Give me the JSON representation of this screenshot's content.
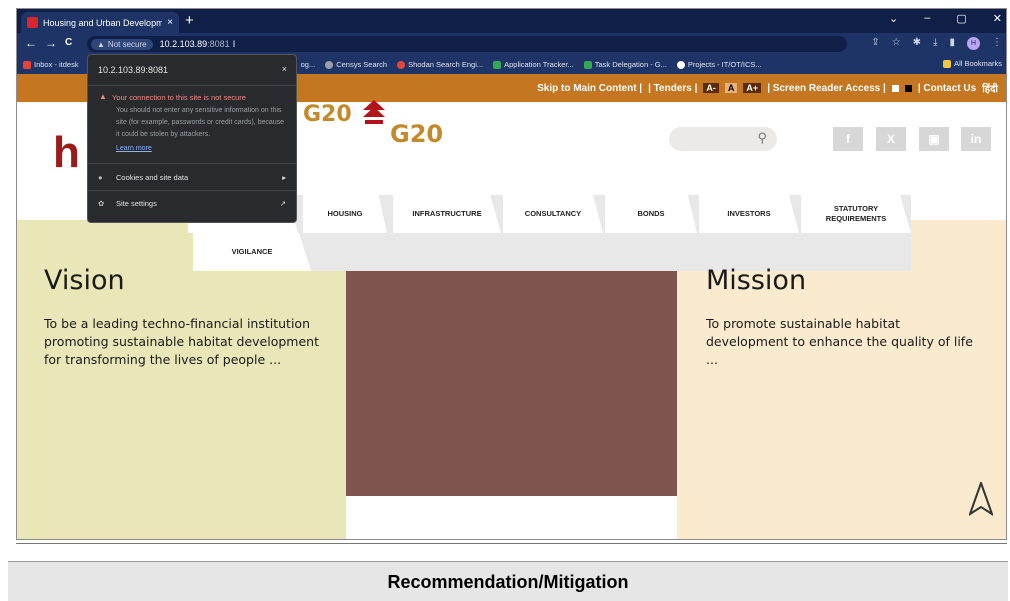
{
  "browser": {
    "tab_title": "Housing and Urban Developme",
    "tab_close": "×",
    "new_tab": "+",
    "window_controls": [
      "⌄",
      "–",
      "▢",
      "✕"
    ],
    "nav": [
      "←",
      "→",
      "C"
    ],
    "not_secure": "Not secure",
    "url_host": "10.2.103.89",
    "url_port": ":8081",
    "cursor": "I",
    "profile_initial": "H",
    "bookmarks": [
      {
        "label": "Inbox - itdesk",
        "color": "#ea4335"
      },
      {
        "label": "og...",
        "color": "#1e3366"
      },
      {
        "label": "Censys Search",
        "color": "#5f6368"
      },
      {
        "label": "Shodan Search Engi...",
        "color": "#e8453c"
      },
      {
        "label": "Application Tracker...",
        "color": "#34a853"
      },
      {
        "label": "Task Delegation - G...",
        "color": "#34a853"
      },
      {
        "label": "Projects - IT/OT/ICS...",
        "color": "#ffffff"
      }
    ],
    "all_bookmarks": "All Bookmarks"
  },
  "site_info_popup": {
    "host": "10.2.103.89:8081",
    "close": "×",
    "warning_title": "Your connection to this site is not secure",
    "warning_body": "You should not enter any sensitive information on this site (for example, passwords or credit cards), because it could be stolen by attackers.",
    "learn_more": "Learn more",
    "cookies": "Cookies and site data",
    "site_settings": "Site settings"
  },
  "site": {
    "topbar": {
      "skip": "Skip to Main Content |",
      "tenders": "| Tenders |",
      "font_minus": "A-",
      "font_normal": "A",
      "font_plus": "A+",
      "screen_reader": "| Screen Reader Access |",
      "contact": "| Contact Us",
      "hindi": "हिंदी"
    },
    "logo_text": "h",
    "g20_text": "G20",
    "social": [
      "f",
      "X",
      "▣",
      "in"
    ],
    "menu": [
      "HOUSING",
      "INFRASTRUCTURE",
      "CONSULTANCY",
      "BONDS",
      "INVESTORS",
      "STATUTORY REQUIREMENTS",
      "VIGILANCE"
    ],
    "vision": {
      "title": "Vision",
      "text": "To be a leading techno-financial institution promoting sustainable habitat development for transforming the lives of people ..."
    },
    "mission": {
      "title": "Mission",
      "text": "To promote sustainable habitat development to enhance the quality of life ..."
    }
  },
  "footer_label": "Recommendation/Mitigation",
  "colors": {
    "chrome_dark": "#0f1f47",
    "chrome": "#1e3366",
    "accent_orange": "#c47620",
    "vision_bg": "#e9e7b7",
    "mission_bg": "#faebcf",
    "brown_panel": "#7f5350",
    "warning": "#f28b82"
  }
}
